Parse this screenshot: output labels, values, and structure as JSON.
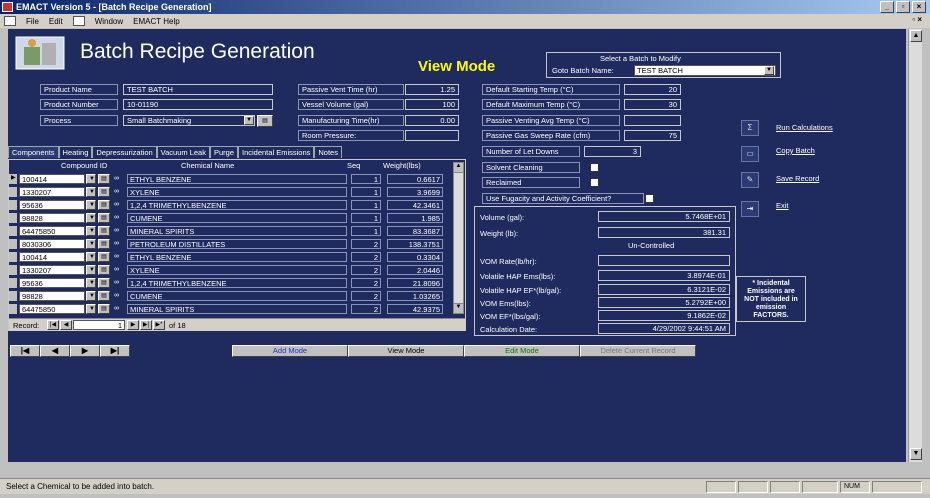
{
  "window": {
    "title": "EMACT Version 5 - [Batch Recipe Generation]"
  },
  "menu": [
    "File",
    "Edit",
    "Window",
    "EMACT Help"
  ],
  "header": {
    "title": "Batch Recipe Generation",
    "mode": "View Mode",
    "select_hint": "Select a Batch to Modify",
    "goto_label": "Goto Batch Name:",
    "goto_value": "TEST BATCH"
  },
  "fields": {
    "product_name_label": "Product Name",
    "product_name": "TEST BATCH",
    "product_number_label": "Product Number",
    "product_number": "10-01190",
    "process_label": "Process",
    "process": "Small Batchmaking",
    "passive_vent_label": "Passive Vent Time (hr)",
    "passive_vent": "1.25",
    "vessel_volume_label": "Vessel Volume (gal)",
    "vessel_volume": "100",
    "manufacturing_label": "Manufacturing Time(hr)",
    "manufacturing": "0.00",
    "room_pressure_label": "Room Pressure:",
    "room_pressure": "",
    "def_start_temp_label": "Default Starting Temp (°C)",
    "def_start_temp": "20",
    "def_max_temp_label": "Default Maximum Temp (°C)",
    "def_max_temp": "30",
    "passive_avg_temp_label": "Passive Venting Avg Temp (°C)",
    "passive_avg_temp": "",
    "passive_gas_label": "Passive Gas Sweep Rate (cfm)",
    "passive_gas": "75",
    "let_downs_label": "Number of Let Downs",
    "let_downs": "3",
    "solvent_cleaning_label": "Solvent Cleaning",
    "reclaimed_label": "Reclaimed",
    "fugacity_label": "Use Fugacity and Activity Coefficient?"
  },
  "tabs": [
    "Components",
    "Heating",
    "Depressurization",
    "Vacuum Leak",
    "Purge",
    "Incidental Emissions",
    "Notes"
  ],
  "grid": {
    "headers": [
      "Compound ID",
      "Chemical Name",
      "Seq",
      "Weight(lbs)"
    ],
    "rows": [
      {
        "id": "100414",
        "name": "ETHYL BENZENE",
        "seq": "1",
        "weight": "0.6617"
      },
      {
        "id": "1330207",
        "name": "XYLENE",
        "seq": "1",
        "weight": "3.9699"
      },
      {
        "id": "95636",
        "name": "1,2,4 TRIMETHYLBENZENE",
        "seq": "1",
        "weight": "42.3461"
      },
      {
        "id": "98828",
        "name": "CUMENE",
        "seq": "1",
        "weight": "1.985"
      },
      {
        "id": "64475850",
        "name": "MINERAL SPIRITS",
        "seq": "1",
        "weight": "83.3687"
      },
      {
        "id": "8030306",
        "name": "PETROLEUM DISTILLATES",
        "seq": "2",
        "weight": "138.3751"
      },
      {
        "id": "100414",
        "name": "ETHYL BENZENE",
        "seq": "2",
        "weight": "0.3304"
      },
      {
        "id": "1330207",
        "name": "XYLENE",
        "seq": "2",
        "weight": "2.0446"
      },
      {
        "id": "95636",
        "name": "1,2,4 TRIMETHYLBENZENE",
        "seq": "2",
        "weight": "21.8096"
      },
      {
        "id": "98828",
        "name": "CUMENE",
        "seq": "2",
        "weight": "1.03265"
      },
      {
        "id": "64475850",
        "name": "MINERAL SPIRITS",
        "seq": "2",
        "weight": "42.9375"
      }
    ],
    "record_label": "Record:",
    "record_current": "1",
    "record_total": "of 18"
  },
  "results": {
    "volume_label": "Volume (gal):",
    "volume": "5.7468E+01",
    "weight_label": "Weight (lb):",
    "weight": "381.31",
    "control_status": "Un-Controlled",
    "vom_rate_label": "VOM Rate(lb/hr):",
    "vom_rate": "",
    "hap_ems_label": "Volatile HAP Ems(lbs):",
    "hap_ems": "3.8974E-01",
    "hap_ef_label": "Volatile HAP EF*(lb/gal):",
    "hap_ef": "6.3121E-02",
    "vom_ems_label": "VOM Ems(lbs):",
    "vom_ems": "5.2792E+00",
    "vom_ef_label": "VOM EF*(lbs/gal):",
    "vom_ef": "9.1862E-02",
    "calc_date_label": "Calculation Date:",
    "calc_date": "4/29/2002 9:44:51 AM"
  },
  "actions": {
    "run": "Run Calculations",
    "copy": "Copy Batch",
    "save": "Save Record",
    "exit": "Exit"
  },
  "note": [
    "* Incidental",
    "Emissions are",
    "NOT included in",
    "emission",
    "FACTORS."
  ],
  "modes": {
    "add": "Add Mode",
    "view": "View Mode",
    "edit": "Edit Mode",
    "delete": "Delete Current Record"
  },
  "status": {
    "text": "Select a Chemical to be added into batch.",
    "num": "NUM"
  }
}
